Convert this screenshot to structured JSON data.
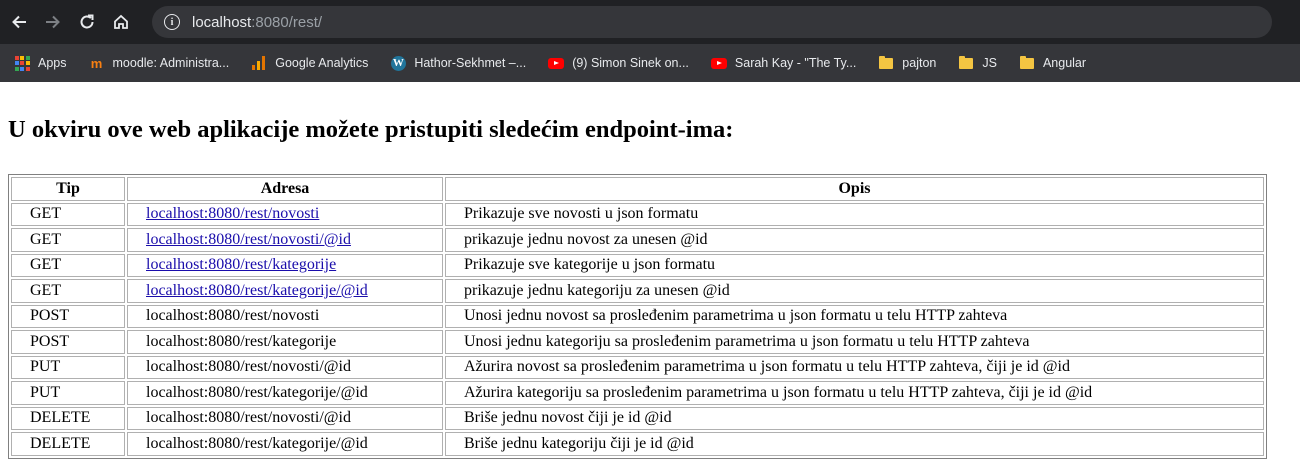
{
  "browser": {
    "url_host": "localhost",
    "url_path": ":8080/rest/",
    "bookmarks": [
      {
        "label": "Apps",
        "icon": "apps-grid-icon"
      },
      {
        "label": "moodle: Administra...",
        "icon": "moodle-icon"
      },
      {
        "label": "Google Analytics",
        "icon": "analytics-icon"
      },
      {
        "label": "Hathor-Sekhmet –...",
        "icon": "wordpress-icon"
      },
      {
        "label": "(9) Simon Sinek on...",
        "icon": "youtube-icon"
      },
      {
        "label": "Sarah Kay - \"The Ty...",
        "icon": "youtube-icon"
      },
      {
        "label": "pajton",
        "icon": "folder-icon"
      },
      {
        "label": "JS",
        "icon": "folder-icon"
      },
      {
        "label": "Angular",
        "icon": "folder-icon"
      }
    ]
  },
  "page": {
    "heading": "U okviru ove web aplikacije možete pristupiti sledećim endpoint-ima:",
    "table": {
      "headers": [
        "Tip",
        "Adresa",
        "Opis"
      ],
      "rows": [
        {
          "tip": "GET",
          "adresa": "localhost:8080/rest/novosti",
          "opis": "Prikazuje sve novosti u json formatu",
          "link": true
        },
        {
          "tip": "GET",
          "adresa": "localhost:8080/rest/novosti/@id",
          "opis": "prikazuje jednu novost za unesen @id",
          "link": true
        },
        {
          "tip": "GET",
          "adresa": "localhost:8080/rest/kategorije",
          "opis": "Prikazuje sve kategorije u json formatu",
          "link": true
        },
        {
          "tip": "GET",
          "adresa": "localhost:8080/rest/kategorije/@id",
          "opis": "prikazuje jednu kategoriju za unesen @id",
          "link": true
        },
        {
          "tip": "POST",
          "adresa": "localhost:8080/rest/novosti",
          "opis": "Unosi jednu novost sa prosleđenim parametrima u json formatu u telu HTTP zahteva",
          "link": false
        },
        {
          "tip": "POST",
          "adresa": "localhost:8080/rest/kategorije",
          "opis": "Unosi jednu kategoriju sa prosleđenim parametrima u json formatu u telu HTTP zahteva",
          "link": false
        },
        {
          "tip": "PUT",
          "adresa": "localhost:8080/rest/novosti/@id",
          "opis": "Ažurira novost sa prosleđenim parametrima u json formatu u telu HTTP zahteva, čiji je id @id",
          "link": false
        },
        {
          "tip": "PUT",
          "adresa": "localhost:8080/rest/kategorije/@id",
          "opis": "Ažurira kategoriju sa prosleđenim parametrima u json formatu u telu HTTP zahteva, čiji je id @id",
          "link": false
        },
        {
          "tip": "DELETE",
          "adresa": "localhost:8080/rest/novosti/@id",
          "opis": "Briše jednu novost čiji je id @id",
          "link": false
        },
        {
          "tip": "DELETE",
          "adresa": "localhost:8080/rest/kategorije/@id",
          "opis": "Briše jednu kategoriju čiji je id @id",
          "link": false
        }
      ]
    }
  }
}
